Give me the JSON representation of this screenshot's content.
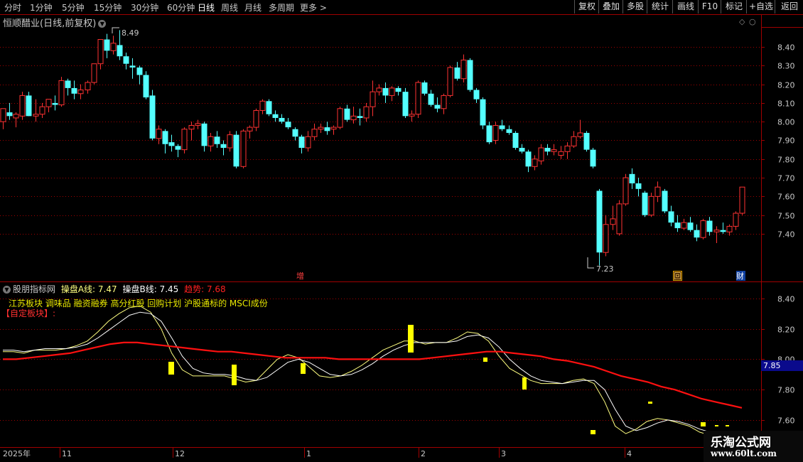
{
  "toolbar": {
    "periods": [
      "分时",
      "1分钟",
      "5分钟",
      "15分钟",
      "30分钟",
      "60分钟",
      "日线",
      "周线",
      "月线",
      "多周期",
      "更多 >"
    ],
    "active_period": "日线",
    "buttons": [
      "复权",
      "叠加",
      "多股",
      "统计",
      "画线",
      "F10",
      "标记",
      "+自选",
      "返回"
    ]
  },
  "stock": {
    "name": "恒顺醋业(日线,前复权)",
    "high_label": "8.49",
    "low_label": "7.23"
  },
  "badges": {
    "zeng": "增",
    "hui": "回",
    "cai": "财"
  },
  "indicator": {
    "name": "股朋指标网",
    "line_a_label": "操盘A线: 7.47",
    "line_b_label": "操盘B线: 7.45",
    "trend_label": "趋势: 7.68",
    "sectors": "江苏板块 调味品 融资融券 高分红股 回购计划 沪股通标的 MSCI成份",
    "custom_label": "【自定板块】:",
    "value_tag": "7.85"
  },
  "dates": {
    "year": "2025年",
    "months": [
      "11",
      "12",
      "1",
      "2",
      "3",
      "4"
    ]
  },
  "watermark": {
    "line1": "乐淘公式网",
    "line2": "www.60lt.com"
  },
  "colors": {
    "up": "#ff3232",
    "down": "#54ffff",
    "trend": "#ff1010",
    "line_a": "#ffff80",
    "line_b": "#ffffff",
    "signal": "#ffff00",
    "axis_red": "#a00000"
  },
  "chart_data": [
    {
      "type": "candlestick",
      "title": "恒顺醋业(日线,前复权)",
      "ylim": [
        7.16,
        8.56
      ],
      "yticks": [
        7.4,
        7.5,
        7.6,
        7.7,
        7.8,
        7.9,
        8.0,
        8.1,
        8.2,
        8.3,
        8.4
      ],
      "ohlc": [
        [
          8.0,
          8.07,
          7.96,
          8.07
        ],
        [
          8.05,
          8.1,
          8.01,
          8.03
        ],
        [
          8.02,
          8.05,
          7.97,
          8.04
        ],
        [
          8.03,
          8.16,
          8.01,
          8.14
        ],
        [
          8.14,
          8.16,
          8.03,
          8.03
        ],
        [
          8.03,
          8.12,
          8.0,
          8.04
        ],
        [
          8.04,
          8.1,
          8.02,
          8.08
        ],
        [
          8.08,
          8.12,
          8.05,
          8.12
        ],
        [
          8.1,
          8.14,
          8.06,
          8.09
        ],
        [
          8.09,
          8.24,
          8.08,
          8.22
        ],
        [
          8.22,
          8.23,
          8.14,
          8.18
        ],
        [
          8.18,
          8.22,
          8.12,
          8.15
        ],
        [
          8.15,
          8.2,
          8.12,
          8.17
        ],
        [
          8.17,
          8.22,
          8.15,
          8.21
        ],
        [
          8.21,
          8.31,
          8.2,
          8.31
        ],
        [
          8.31,
          8.44,
          8.28,
          8.44
        ],
        [
          8.44,
          8.47,
          8.34,
          8.38
        ],
        [
          8.38,
          8.46,
          8.36,
          8.42
        ],
        [
          8.41,
          8.49,
          8.33,
          8.35
        ],
        [
          8.35,
          8.37,
          8.28,
          8.31
        ],
        [
          8.3,
          8.34,
          8.23,
          8.29
        ],
        [
          8.29,
          8.3,
          8.2,
          8.25
        ],
        [
          8.25,
          8.27,
          8.12,
          8.13
        ],
        [
          8.14,
          8.17,
          7.9,
          7.91
        ],
        [
          7.91,
          7.98,
          7.88,
          7.96
        ],
        [
          7.95,
          7.96,
          7.83,
          7.88
        ],
        [
          7.89,
          7.93,
          7.84,
          7.87
        ],
        [
          7.87,
          7.88,
          7.81,
          7.85
        ],
        [
          7.85,
          7.97,
          7.83,
          7.96
        ],
        [
          7.96,
          8.0,
          7.9,
          7.98
        ],
        [
          7.98,
          8.01,
          7.96,
          7.99
        ],
        [
          7.99,
          8.0,
          7.84,
          7.87
        ],
        [
          7.87,
          7.94,
          7.84,
          7.92
        ],
        [
          7.92,
          7.95,
          7.86,
          7.88
        ],
        [
          7.88,
          7.9,
          7.82,
          7.86
        ],
        [
          7.86,
          7.95,
          7.84,
          7.93
        ],
        [
          7.93,
          7.95,
          7.75,
          7.76
        ],
        [
          7.76,
          7.96,
          7.75,
          7.95
        ],
        [
          7.95,
          7.98,
          7.91,
          7.97
        ],
        [
          7.97,
          8.07,
          7.95,
          8.06
        ],
        [
          8.06,
          8.12,
          8.04,
          8.11
        ],
        [
          8.11,
          8.12,
          8.03,
          8.04
        ],
        [
          8.04,
          8.06,
          8.0,
          8.02
        ],
        [
          8.02,
          8.04,
          7.99,
          8.0
        ],
        [
          8.0,
          8.02,
          7.96,
          7.97
        ],
        [
          7.96,
          7.97,
          7.9,
          7.92
        ],
        [
          7.92,
          7.93,
          7.83,
          7.86
        ],
        [
          7.86,
          7.95,
          7.84,
          7.92
        ],
        [
          7.92,
          7.99,
          7.9,
          7.96
        ],
        [
          7.96,
          7.99,
          7.94,
          7.97
        ],
        [
          7.97,
          8.0,
          7.93,
          7.95
        ],
        [
          7.96,
          7.98,
          7.93,
          7.97
        ],
        [
          7.97,
          8.08,
          7.96,
          8.07
        ],
        [
          8.07,
          8.09,
          8.0,
          8.01
        ],
        [
          8.01,
          8.08,
          7.99,
          8.03
        ],
        [
          8.03,
          8.07,
          7.98,
          8.02
        ],
        [
          8.02,
          8.1,
          8.0,
          8.08
        ],
        [
          8.08,
          8.22,
          8.03,
          8.16
        ],
        [
          8.16,
          8.2,
          8.14,
          8.18
        ],
        [
          8.18,
          8.21,
          8.1,
          8.14
        ],
        [
          8.14,
          8.19,
          8.11,
          8.18
        ],
        [
          8.18,
          8.19,
          8.14,
          8.16
        ],
        [
          8.16,
          8.18,
          8.02,
          8.03
        ],
        [
          8.03,
          8.06,
          8.0,
          8.04
        ],
        [
          8.04,
          8.22,
          8.02,
          8.21
        ],
        [
          8.21,
          8.22,
          8.14,
          8.15
        ],
        [
          8.15,
          8.17,
          8.08,
          8.09
        ],
        [
          8.09,
          8.13,
          8.05,
          8.07
        ],
        [
          8.07,
          8.15,
          8.04,
          8.14
        ],
        [
          8.14,
          8.3,
          8.13,
          8.29
        ],
        [
          8.29,
          8.32,
          8.22,
          8.23
        ],
        [
          8.23,
          8.36,
          8.21,
          8.33
        ],
        [
          8.33,
          8.34,
          8.16,
          8.17
        ],
        [
          8.17,
          8.18,
          8.1,
          8.12
        ],
        [
          8.12,
          8.13,
          7.96,
          7.98
        ],
        [
          7.98,
          8.0,
          7.88,
          7.89
        ],
        [
          7.9,
          8.0,
          7.88,
          7.98
        ],
        [
          7.98,
          8.01,
          7.95,
          7.96
        ],
        [
          7.96,
          7.98,
          7.93,
          7.94
        ],
        [
          7.94,
          7.95,
          7.85,
          7.86
        ],
        [
          7.86,
          7.88,
          7.83,
          7.84
        ],
        [
          7.84,
          7.85,
          7.73,
          7.76
        ],
        [
          7.76,
          7.82,
          7.74,
          7.8
        ],
        [
          7.79,
          7.88,
          7.77,
          7.86
        ],
        [
          7.86,
          7.88,
          7.82,
          7.84
        ],
        [
          7.84,
          7.88,
          7.82,
          7.85
        ],
        [
          7.82,
          7.87,
          7.8,
          7.84
        ],
        [
          7.84,
          7.89,
          7.8,
          7.87
        ],
        [
          7.87,
          7.95,
          7.86,
          7.92
        ],
        [
          7.92,
          8.01,
          7.91,
          7.94
        ],
        [
          7.94,
          7.95,
          7.84,
          7.85
        ],
        [
          7.85,
          7.86,
          7.75,
          7.76
        ],
        [
          7.63,
          7.64,
          7.23,
          7.3
        ],
        [
          7.3,
          7.5,
          7.28,
          7.45
        ],
        [
          7.45,
          7.55,
          7.42,
          7.48
        ],
        [
          7.4,
          7.58,
          7.39,
          7.56
        ],
        [
          7.56,
          7.72,
          7.55,
          7.7
        ],
        [
          7.72,
          7.75,
          7.64,
          7.67
        ],
        [
          7.67,
          7.7,
          7.6,
          7.64
        ],
        [
          7.62,
          7.63,
          7.49,
          7.5
        ],
        [
          7.5,
          7.62,
          7.49,
          7.6
        ],
        [
          7.6,
          7.68,
          7.57,
          7.65
        ],
        [
          7.63,
          7.64,
          7.51,
          7.52
        ],
        [
          7.52,
          7.55,
          7.44,
          7.46
        ],
        [
          7.46,
          7.5,
          7.41,
          7.43
        ],
        [
          7.43,
          7.48,
          7.42,
          7.46
        ],
        [
          7.46,
          7.49,
          7.41,
          7.42
        ],
        [
          7.42,
          7.45,
          7.36,
          7.38
        ],
        [
          7.38,
          7.48,
          7.37,
          7.47
        ],
        [
          7.47,
          7.49,
          7.39,
          7.41
        ],
        [
          7.41,
          7.44,
          7.35,
          7.42
        ],
        [
          7.42,
          7.46,
          7.4,
          7.41
        ],
        [
          7.41,
          7.45,
          7.39,
          7.44
        ],
        [
          7.44,
          7.52,
          7.42,
          7.51
        ],
        [
          7.51,
          7.65,
          7.5,
          7.65
        ]
      ]
    },
    {
      "type": "line",
      "title": "股朋指标网",
      "ylim": [
        7.52,
        8.47
      ],
      "yticks": [
        7.6,
        7.8,
        8.0,
        8.2,
        8.4
      ],
      "series": [
        {
          "name": "操盘A线",
          "values": [
            8.05,
            8.05,
            8.04,
            8.06,
            8.06,
            8.06,
            8.07,
            8.09,
            8.12,
            8.18,
            8.25,
            8.3,
            8.34,
            8.35,
            8.31,
            8.2,
            8.04,
            7.93,
            7.89,
            7.89,
            7.89,
            7.89,
            7.87,
            7.85,
            7.86,
            7.93,
            8.0,
            8.03,
            8.01,
            7.95,
            7.89,
            7.88,
            7.89,
            7.92,
            7.96,
            8.01,
            8.06,
            8.09,
            8.12,
            8.12,
            8.1,
            8.11,
            8.11,
            8.14,
            8.18,
            8.17,
            8.12,
            8.02,
            7.94,
            7.9,
            7.86,
            7.84,
            7.84,
            7.84,
            7.86,
            7.87,
            7.84,
            7.72,
            7.56,
            7.51,
            7.54,
            7.59,
            7.61,
            7.6,
            7.58,
            7.56,
            7.52,
            7.5,
            7.48,
            7.46,
            7.47
          ]
        },
        {
          "name": "操盘B线",
          "values": [
            8.06,
            8.06,
            8.05,
            8.06,
            8.07,
            8.07,
            8.07,
            8.08,
            8.1,
            8.14,
            8.19,
            8.24,
            8.29,
            8.31,
            8.3,
            8.25,
            8.14,
            8.02,
            7.94,
            7.91,
            7.9,
            7.9,
            7.89,
            7.87,
            7.86,
            7.88,
            7.93,
            7.98,
            8.0,
            7.98,
            7.94,
            7.9,
            7.89,
            7.9,
            7.93,
            7.97,
            8.02,
            8.06,
            8.09,
            8.11,
            8.11,
            8.11,
            8.11,
            8.12,
            8.15,
            8.16,
            8.14,
            8.08,
            8.0,
            7.94,
            7.89,
            7.86,
            7.85,
            7.84,
            7.85,
            7.86,
            7.86,
            7.8,
            7.67,
            7.56,
            7.53,
            7.55,
            7.58,
            7.6,
            7.59,
            7.57,
            7.54,
            7.52,
            7.5,
            7.48,
            7.45
          ]
        },
        {
          "name": "趋势",
          "values": [
            8.0,
            8.0,
            8.01,
            8.02,
            8.03,
            8.04,
            8.06,
            8.08,
            8.1,
            8.11,
            8.11,
            8.1,
            8.09,
            8.08,
            8.07,
            8.06,
            8.05,
            8.05,
            8.04,
            8.03,
            8.02,
            8.01,
            8.01,
            8.01,
            8.01,
            8.0,
            8.0,
            8.0,
            8.0,
            8.0,
            8.0,
            8.0,
            8.01,
            8.02,
            8.03,
            8.04,
            8.05,
            8.05,
            8.04,
            8.03,
            8.02,
            8.0,
            7.99,
            7.97,
            7.95,
            7.92,
            7.89,
            7.87,
            7.85,
            7.82,
            7.8,
            7.77,
            7.74,
            7.72,
            7.7,
            7.68
          ]
        }
      ]
    }
  ]
}
